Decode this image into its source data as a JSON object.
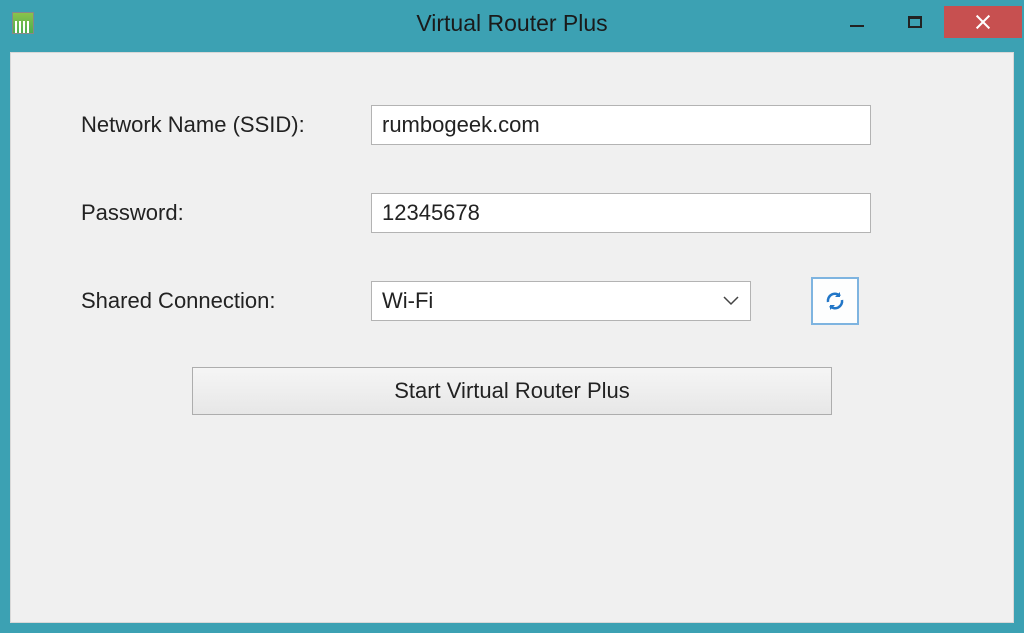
{
  "window": {
    "title": "Virtual Router Plus"
  },
  "form": {
    "ssid_label": "Network Name (SSID):",
    "ssid_value": "rumbogeek.com",
    "password_label": "Password:",
    "password_value": "12345678",
    "connection_label": "Shared Connection:",
    "connection_value": "Wi-Fi",
    "start_label": "Start Virtual Router Plus"
  },
  "icons": {
    "refresh": "refresh-icon",
    "chevron_down": "chevron-down-icon",
    "app": "app-icon"
  }
}
